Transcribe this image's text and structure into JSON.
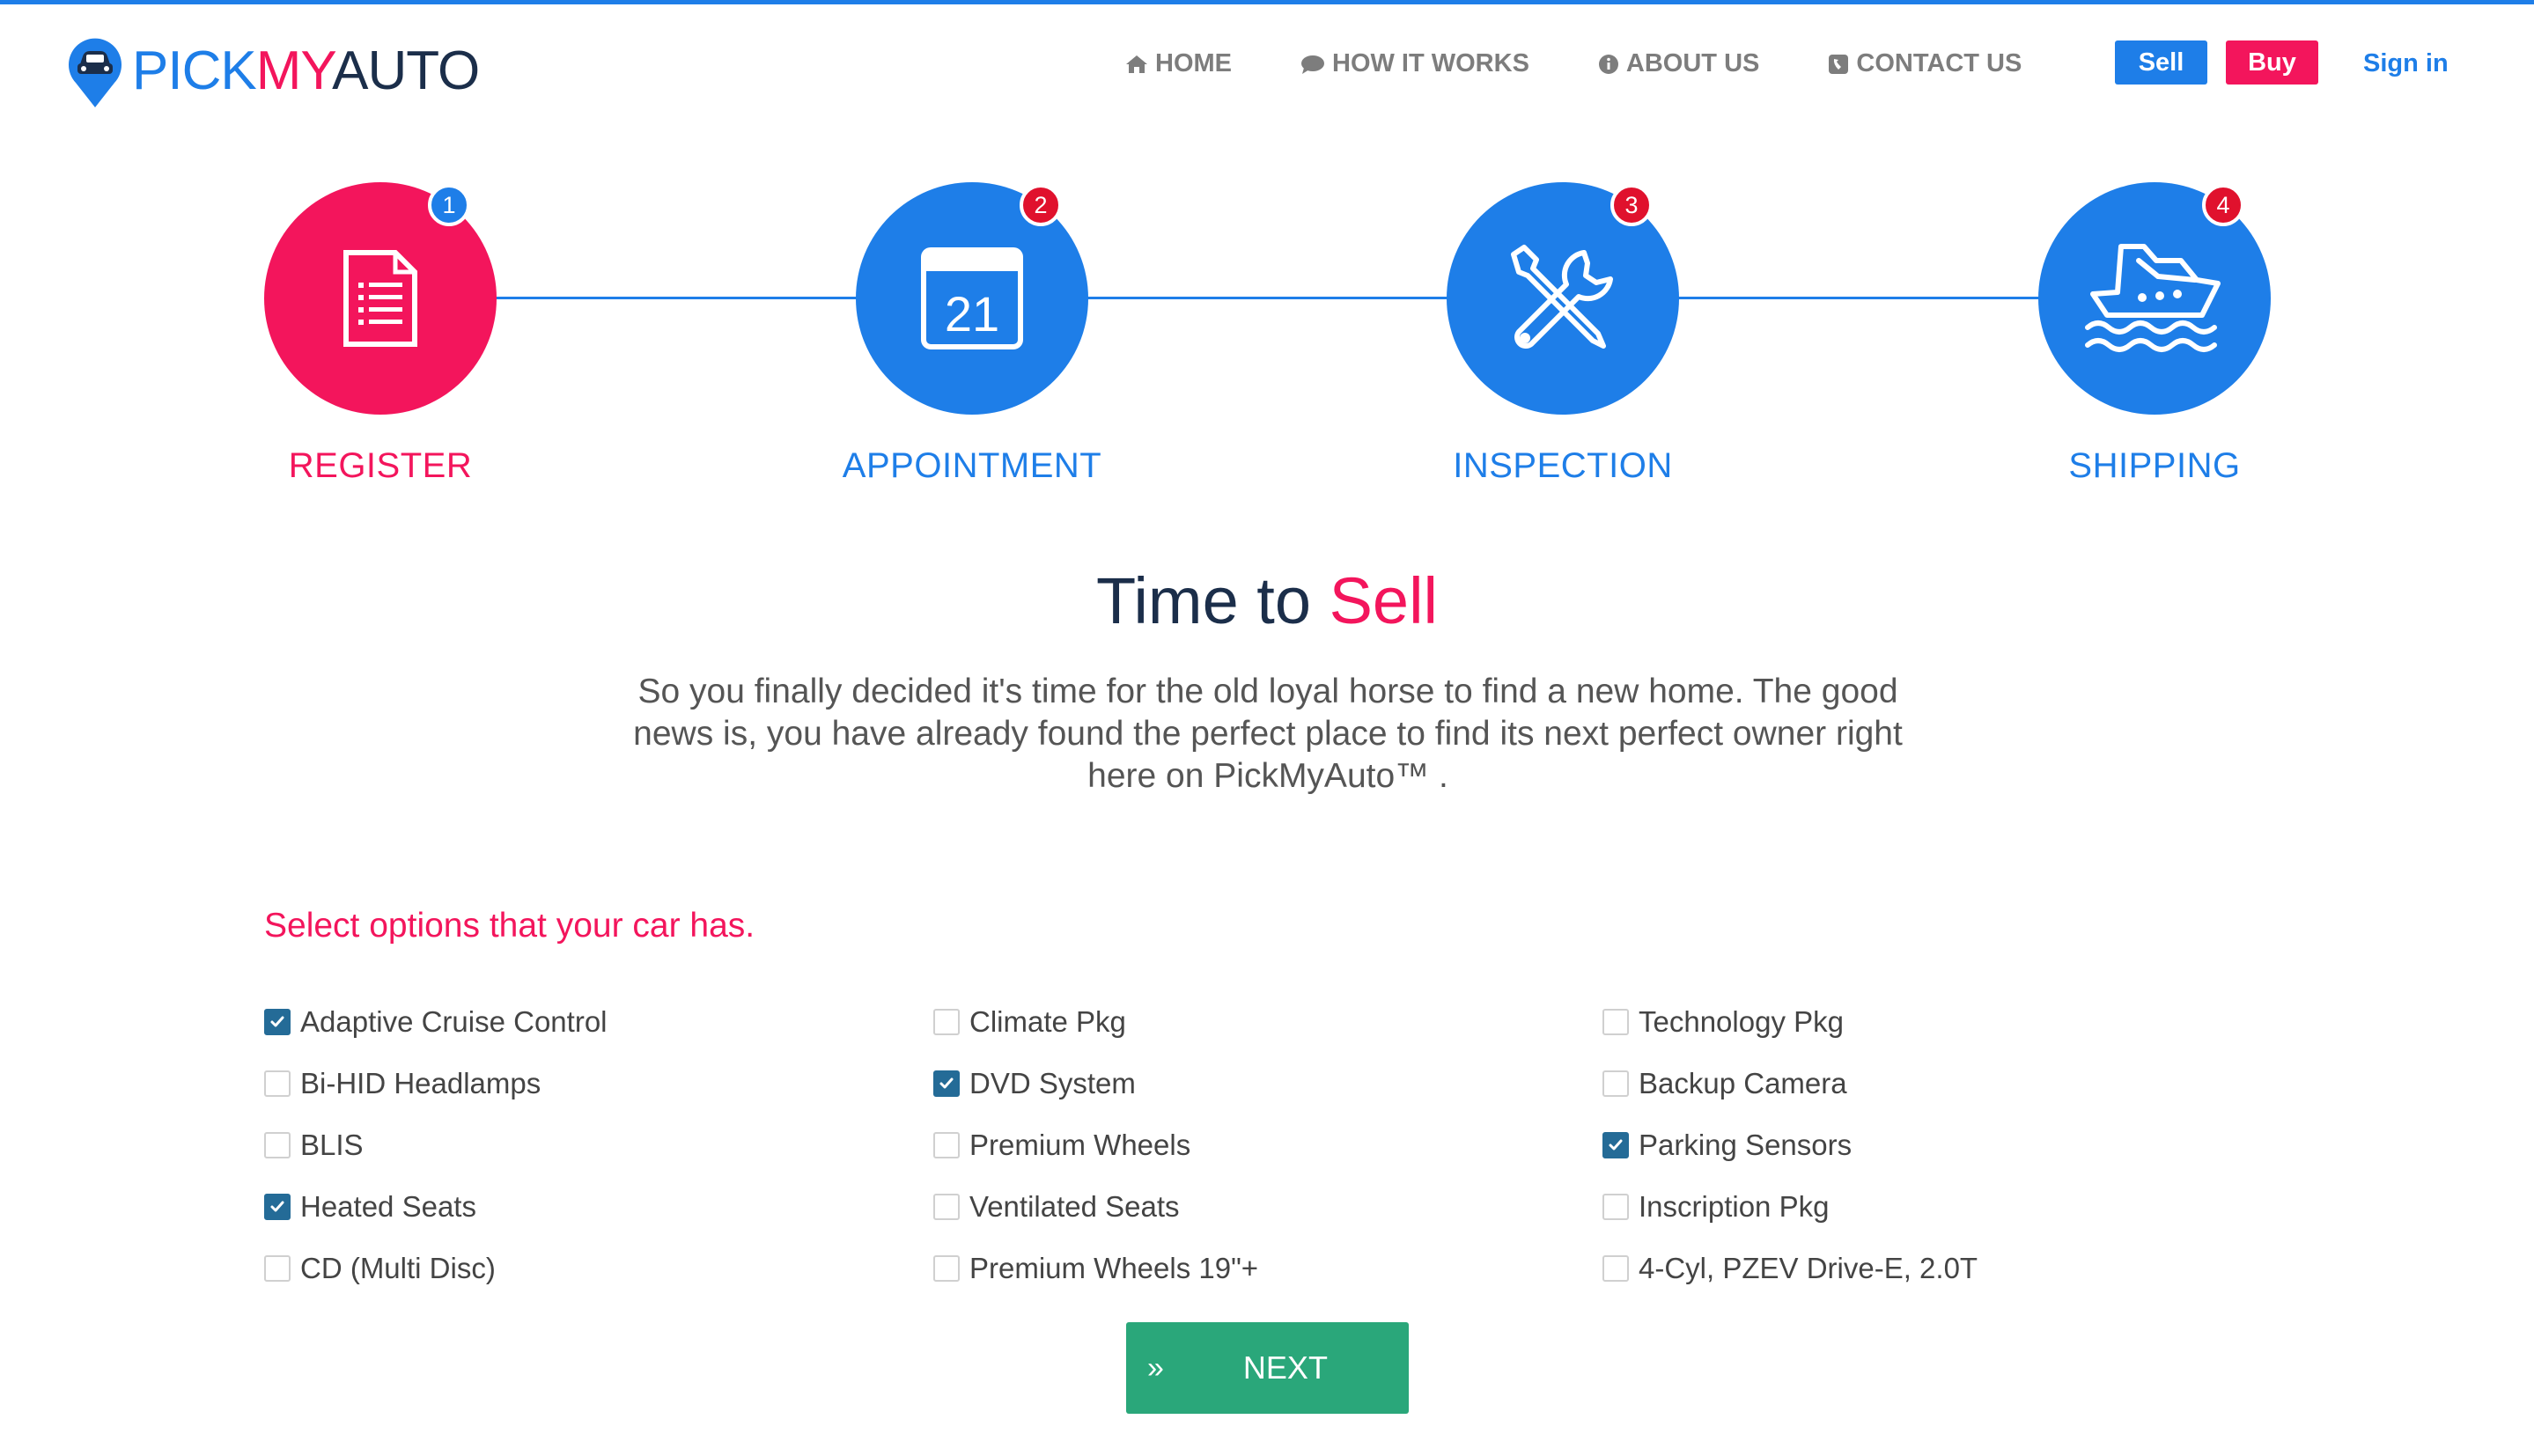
{
  "brand": {
    "part1": "PICK",
    "part2": "MY",
    "part3": "AUTO",
    "colors": {
      "blue": "#1e7ee8",
      "pink": "#f3155c",
      "navy": "#1b2e4a"
    }
  },
  "nav": {
    "items": [
      {
        "label": "HOME",
        "icon": "home-icon"
      },
      {
        "label": "HOW IT WORKS",
        "icon": "chat-icon"
      },
      {
        "label": "ABOUT US",
        "icon": "info-icon"
      },
      {
        "label": "CONTACT US",
        "icon": "phone-icon"
      }
    ],
    "sell": "Sell",
    "buy": "Buy",
    "signin": "Sign in"
  },
  "steps": [
    {
      "number": "1",
      "label": "REGISTER",
      "icon": "document-icon",
      "active": true
    },
    {
      "number": "2",
      "label": "APPOINTMENT",
      "icon": "calendar-icon",
      "calendar_day": "21"
    },
    {
      "number": "3",
      "label": "INSPECTION",
      "icon": "tools-icon"
    },
    {
      "number": "4",
      "label": "SHIPPING",
      "icon": "ship-icon"
    }
  ],
  "headline": {
    "part1": "Time to ",
    "part2": "Sell"
  },
  "intro": "So you finally decided it's time for the old loyal horse to find a new home. The good news is, you have already found the perfect place to find its next perfect owner right here on PickMyAuto™ .",
  "options_title": "Select options that your car has.",
  "options": [
    [
      {
        "label": "Adaptive Cruise Control",
        "checked": true
      },
      {
        "label": "Bi-HID Headlamps",
        "checked": false
      },
      {
        "label": "BLIS",
        "checked": false
      },
      {
        "label": "Heated Seats",
        "checked": true
      },
      {
        "label": "CD (Multi Disc)",
        "checked": false
      }
    ],
    [
      {
        "label": "Climate Pkg",
        "checked": false
      },
      {
        "label": "DVD System",
        "checked": true
      },
      {
        "label": "Premium Wheels",
        "checked": false
      },
      {
        "label": "Ventilated Seats",
        "checked": false
      },
      {
        "label": "Premium Wheels 19\"+",
        "checked": false
      }
    ],
    [
      {
        "label": "Technology Pkg",
        "checked": false
      },
      {
        "label": "Backup Camera",
        "checked": false
      },
      {
        "label": "Parking Sensors",
        "checked": true
      },
      {
        "label": "Inscription Pkg",
        "checked": false
      },
      {
        "label": "4-Cyl, PZEV Drive-E, 2.0T",
        "checked": false
      }
    ]
  ],
  "next_button": {
    "arrows": "»",
    "label": "NEXT"
  }
}
